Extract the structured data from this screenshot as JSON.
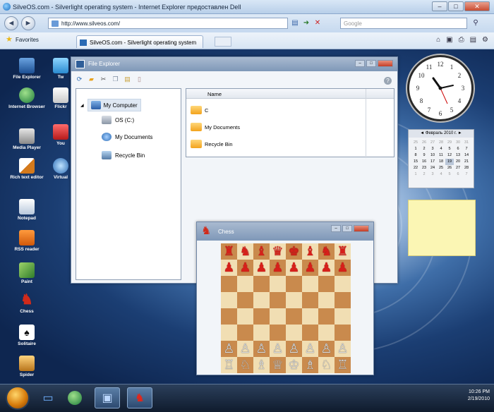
{
  "browser": {
    "title": "SilveOS.com - Silverlight operating system - Internet Explorer предоставлен Dell",
    "address": "http://www.silveos.com/",
    "search_placeholder": "Google",
    "favorites_label": "Favorites",
    "tab_title": "SilveOS.com - Silverlight operating system"
  },
  "desktop_icons": [
    {
      "label": "File Explorer",
      "icon": "computer-icon"
    },
    {
      "label": "Internet Browser",
      "icon": "globe-icon"
    },
    {
      "label": "Media Player",
      "icon": "media-icon"
    },
    {
      "label": "Rich text editor",
      "icon": "pencil-icon"
    },
    {
      "label": "Notepad",
      "icon": "notepad-icon"
    },
    {
      "label": "RSS reader",
      "icon": "rss-icon"
    },
    {
      "label": "Paint",
      "icon": "paint-icon"
    },
    {
      "label": "Chess",
      "icon": "chess-knight-icon"
    },
    {
      "label": "Solitaire",
      "icon": "cards-icon"
    },
    {
      "label": "Spider",
      "icon": "spider-icon"
    }
  ],
  "desktop_icons_col2": [
    {
      "label": "Tw",
      "icon": "twitter-icon"
    },
    {
      "label": "Flickr",
      "icon": "flickr-icon"
    },
    {
      "label": "You",
      "icon": "youtube-icon"
    },
    {
      "label": "Virtual",
      "icon": "virtual-icon"
    }
  ],
  "file_explorer": {
    "title": "File Explorer",
    "tree": [
      {
        "label": "My Computer"
      },
      {
        "label": "OS (C:)"
      },
      {
        "label": "My Documents"
      },
      {
        "label": "Recycle Bin"
      }
    ],
    "column_name": "Name",
    "items": [
      {
        "name": "C"
      },
      {
        "name": "My Documents"
      },
      {
        "name": "Recycle Bin"
      }
    ]
  },
  "chess": {
    "title": "Chess",
    "board": [
      [
        "♜",
        "♞",
        "♝",
        "♛",
        "♚",
        "♝",
        "♞",
        "♜"
      ],
      [
        "♟",
        "♟",
        "♟",
        "♟",
        "♟",
        "♟",
        "♟",
        "♟"
      ],
      [
        "",
        "",
        "",
        "",
        "",
        "",
        "",
        ""
      ],
      [
        "",
        "",
        "",
        "",
        "",
        "",
        "",
        ""
      ],
      [
        "",
        "",
        "",
        "",
        "",
        "",
        "",
        ""
      ],
      [
        "",
        "",
        "",
        "",
        "",
        "",
        "",
        ""
      ],
      [
        "♙",
        "♙",
        "♙",
        "♙",
        "♙",
        "♙",
        "♙",
        "♙"
      ],
      [
        "♖",
        "♘",
        "♗",
        "♕",
        "♔",
        "♗",
        "♘",
        "♖"
      ]
    ]
  },
  "calendar": {
    "header": "◄  Февраль 2010 г.  ►",
    "days": [
      "25",
      "26",
      "27",
      "28",
      "29",
      "30",
      "31",
      "1",
      "2",
      "3",
      "4",
      "5",
      "6",
      "7",
      "8",
      "9",
      "10",
      "11",
      "12",
      "13",
      "14",
      "15",
      "16",
      "17",
      "18",
      "19",
      "20",
      "21",
      "22",
      "23",
      "24",
      "25",
      "26",
      "27",
      "28",
      "1",
      "2",
      "3",
      "4",
      "5",
      "6",
      "7"
    ]
  },
  "taskbar": {
    "time": "10:26 PM",
    "date": "2/19/2010"
  }
}
